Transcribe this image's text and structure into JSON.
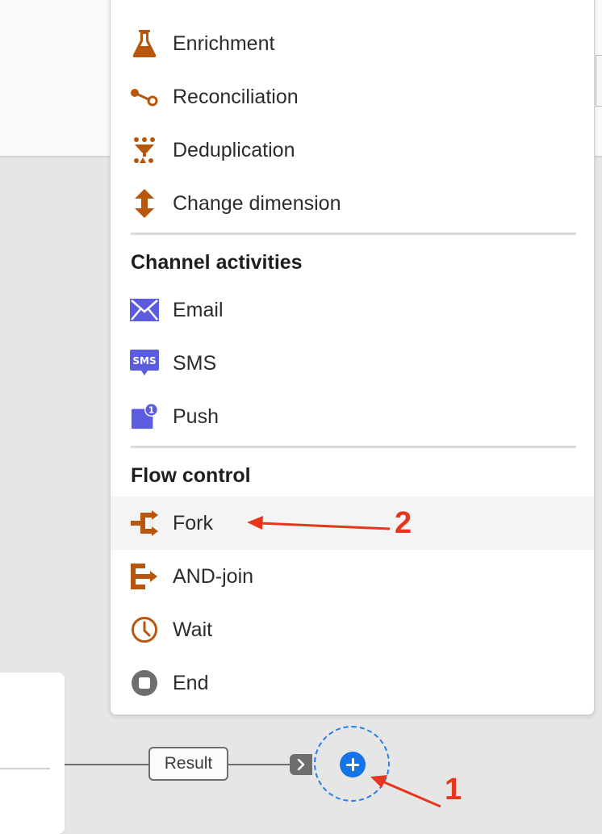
{
  "colors": {
    "transform_icon": "#b8560e",
    "channel_icon": "#5c5ce0",
    "flow_icon": "#b8560e",
    "end_icon": "#6e6e6e",
    "accent_blue": "#1473e6",
    "annotation_red": "#e8361e"
  },
  "menu": {
    "transform_items": [
      {
        "label": "Enrichment",
        "icon": "flask-icon"
      },
      {
        "label": "Reconciliation",
        "icon": "reconciliation-icon"
      },
      {
        "label": "Deduplication",
        "icon": "deduplication-icon"
      },
      {
        "label": "Change dimension",
        "icon": "change-dimension-icon"
      }
    ],
    "channel_header": "Channel activities",
    "channel_items": [
      {
        "label": "Email",
        "icon": "email-icon"
      },
      {
        "label": "SMS",
        "icon": "sms-icon",
        "icon_text": "SMS"
      },
      {
        "label": "Push",
        "icon": "push-icon",
        "badge": "1"
      }
    ],
    "flow_header": "Flow control",
    "flow_items": [
      {
        "label": "Fork",
        "icon": "fork-icon",
        "hovered": true
      },
      {
        "label": "AND-join",
        "icon": "and-join-icon"
      },
      {
        "label": "Wait",
        "icon": "clock-icon"
      },
      {
        "label": "End",
        "icon": "stop-icon"
      }
    ]
  },
  "canvas": {
    "transition_label": "Result",
    "add_button_icon": "plus-circle-icon",
    "chevron_icon": "chevron-right-icon"
  },
  "annotations": {
    "marker_1": "1",
    "marker_2": "2"
  }
}
